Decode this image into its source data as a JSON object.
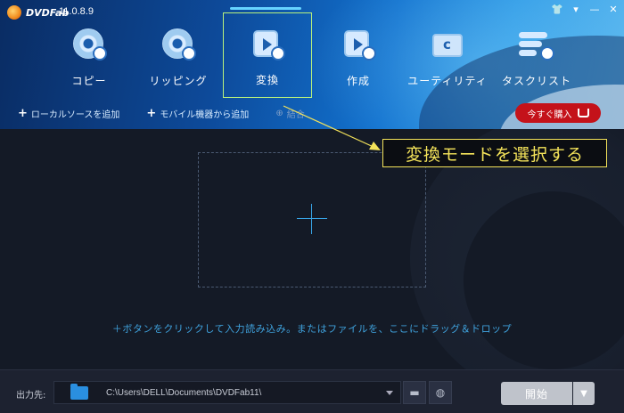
{
  "app": {
    "logo_text": "DVDFab",
    "version": "11.0.8.9"
  },
  "window_controls": {
    "shirt": "👕",
    "menu": "▾",
    "minimize": "—",
    "close": "✕"
  },
  "tabs": [
    {
      "label": "コピー",
      "icon": "copy-disc-icon",
      "active": false
    },
    {
      "label": "リッピング",
      "icon": "ripper-disc-icon",
      "active": false
    },
    {
      "label": "変換",
      "icon": "converter-film-icon",
      "active": true
    },
    {
      "label": "作成",
      "icon": "creator-film-icon",
      "active": false
    },
    {
      "label": "ユーティリティ",
      "icon": "utility-folder-icon",
      "active": false
    },
    {
      "label": "タスクリスト",
      "icon": "tasklist-icon",
      "active": false
    }
  ],
  "actions": {
    "add_local": "ローカルソースを追加",
    "add_mobile": "モバイル機器から追加",
    "merge": "結合"
  },
  "buy": {
    "label": "今すぐ購入"
  },
  "callout": {
    "text": "変換モードを選択する"
  },
  "main": {
    "hint": "＋ボタンをクリックして入力読み込み。またはファイルを、ここにドラッグ＆ドロップ"
  },
  "bottom": {
    "output_label": "出力先:",
    "output_path": "C:\\Users\\DELL\\Documents\\DVDFab11\\",
    "start_label": "開始"
  },
  "colors": {
    "accent": "#38a6e8",
    "highlight_border": "#b9f27c",
    "callout": "#f4e35a",
    "buy": "#c4121a"
  }
}
